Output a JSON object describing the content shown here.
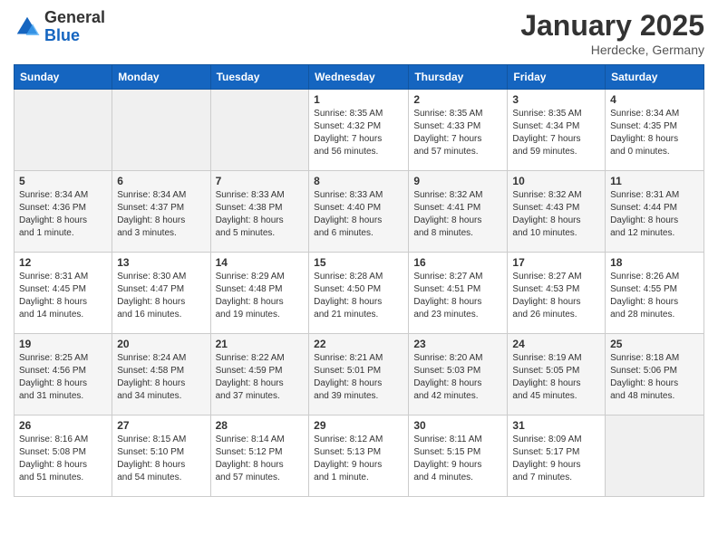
{
  "header": {
    "logo_general": "General",
    "logo_blue": "Blue",
    "month_year": "January 2025",
    "location": "Herdecke, Germany"
  },
  "weekdays": [
    "Sunday",
    "Monday",
    "Tuesday",
    "Wednesday",
    "Thursday",
    "Friday",
    "Saturday"
  ],
  "weeks": [
    [
      {
        "day": "",
        "info": ""
      },
      {
        "day": "",
        "info": ""
      },
      {
        "day": "",
        "info": ""
      },
      {
        "day": "1",
        "info": "Sunrise: 8:35 AM\nSunset: 4:32 PM\nDaylight: 7 hours\nand 56 minutes."
      },
      {
        "day": "2",
        "info": "Sunrise: 8:35 AM\nSunset: 4:33 PM\nDaylight: 7 hours\nand 57 minutes."
      },
      {
        "day": "3",
        "info": "Sunrise: 8:35 AM\nSunset: 4:34 PM\nDaylight: 7 hours\nand 59 minutes."
      },
      {
        "day": "4",
        "info": "Sunrise: 8:34 AM\nSunset: 4:35 PM\nDaylight: 8 hours\nand 0 minutes."
      }
    ],
    [
      {
        "day": "5",
        "info": "Sunrise: 8:34 AM\nSunset: 4:36 PM\nDaylight: 8 hours\nand 1 minute."
      },
      {
        "day": "6",
        "info": "Sunrise: 8:34 AM\nSunset: 4:37 PM\nDaylight: 8 hours\nand 3 minutes."
      },
      {
        "day": "7",
        "info": "Sunrise: 8:33 AM\nSunset: 4:38 PM\nDaylight: 8 hours\nand 5 minutes."
      },
      {
        "day": "8",
        "info": "Sunrise: 8:33 AM\nSunset: 4:40 PM\nDaylight: 8 hours\nand 6 minutes."
      },
      {
        "day": "9",
        "info": "Sunrise: 8:32 AM\nSunset: 4:41 PM\nDaylight: 8 hours\nand 8 minutes."
      },
      {
        "day": "10",
        "info": "Sunrise: 8:32 AM\nSunset: 4:43 PM\nDaylight: 8 hours\nand 10 minutes."
      },
      {
        "day": "11",
        "info": "Sunrise: 8:31 AM\nSunset: 4:44 PM\nDaylight: 8 hours\nand 12 minutes."
      }
    ],
    [
      {
        "day": "12",
        "info": "Sunrise: 8:31 AM\nSunset: 4:45 PM\nDaylight: 8 hours\nand 14 minutes."
      },
      {
        "day": "13",
        "info": "Sunrise: 8:30 AM\nSunset: 4:47 PM\nDaylight: 8 hours\nand 16 minutes."
      },
      {
        "day": "14",
        "info": "Sunrise: 8:29 AM\nSunset: 4:48 PM\nDaylight: 8 hours\nand 19 minutes."
      },
      {
        "day": "15",
        "info": "Sunrise: 8:28 AM\nSunset: 4:50 PM\nDaylight: 8 hours\nand 21 minutes."
      },
      {
        "day": "16",
        "info": "Sunrise: 8:27 AM\nSunset: 4:51 PM\nDaylight: 8 hours\nand 23 minutes."
      },
      {
        "day": "17",
        "info": "Sunrise: 8:27 AM\nSunset: 4:53 PM\nDaylight: 8 hours\nand 26 minutes."
      },
      {
        "day": "18",
        "info": "Sunrise: 8:26 AM\nSunset: 4:55 PM\nDaylight: 8 hours\nand 28 minutes."
      }
    ],
    [
      {
        "day": "19",
        "info": "Sunrise: 8:25 AM\nSunset: 4:56 PM\nDaylight: 8 hours\nand 31 minutes."
      },
      {
        "day": "20",
        "info": "Sunrise: 8:24 AM\nSunset: 4:58 PM\nDaylight: 8 hours\nand 34 minutes."
      },
      {
        "day": "21",
        "info": "Sunrise: 8:22 AM\nSunset: 4:59 PM\nDaylight: 8 hours\nand 37 minutes."
      },
      {
        "day": "22",
        "info": "Sunrise: 8:21 AM\nSunset: 5:01 PM\nDaylight: 8 hours\nand 39 minutes."
      },
      {
        "day": "23",
        "info": "Sunrise: 8:20 AM\nSunset: 5:03 PM\nDaylight: 8 hours\nand 42 minutes."
      },
      {
        "day": "24",
        "info": "Sunrise: 8:19 AM\nSunset: 5:05 PM\nDaylight: 8 hours\nand 45 minutes."
      },
      {
        "day": "25",
        "info": "Sunrise: 8:18 AM\nSunset: 5:06 PM\nDaylight: 8 hours\nand 48 minutes."
      }
    ],
    [
      {
        "day": "26",
        "info": "Sunrise: 8:16 AM\nSunset: 5:08 PM\nDaylight: 8 hours\nand 51 minutes."
      },
      {
        "day": "27",
        "info": "Sunrise: 8:15 AM\nSunset: 5:10 PM\nDaylight: 8 hours\nand 54 minutes."
      },
      {
        "day": "28",
        "info": "Sunrise: 8:14 AM\nSunset: 5:12 PM\nDaylight: 8 hours\nand 57 minutes."
      },
      {
        "day": "29",
        "info": "Sunrise: 8:12 AM\nSunset: 5:13 PM\nDaylight: 9 hours\nand 1 minute."
      },
      {
        "day": "30",
        "info": "Sunrise: 8:11 AM\nSunset: 5:15 PM\nDaylight: 9 hours\nand 4 minutes."
      },
      {
        "day": "31",
        "info": "Sunrise: 8:09 AM\nSunset: 5:17 PM\nDaylight: 9 hours\nand 7 minutes."
      },
      {
        "day": "",
        "info": ""
      }
    ]
  ]
}
